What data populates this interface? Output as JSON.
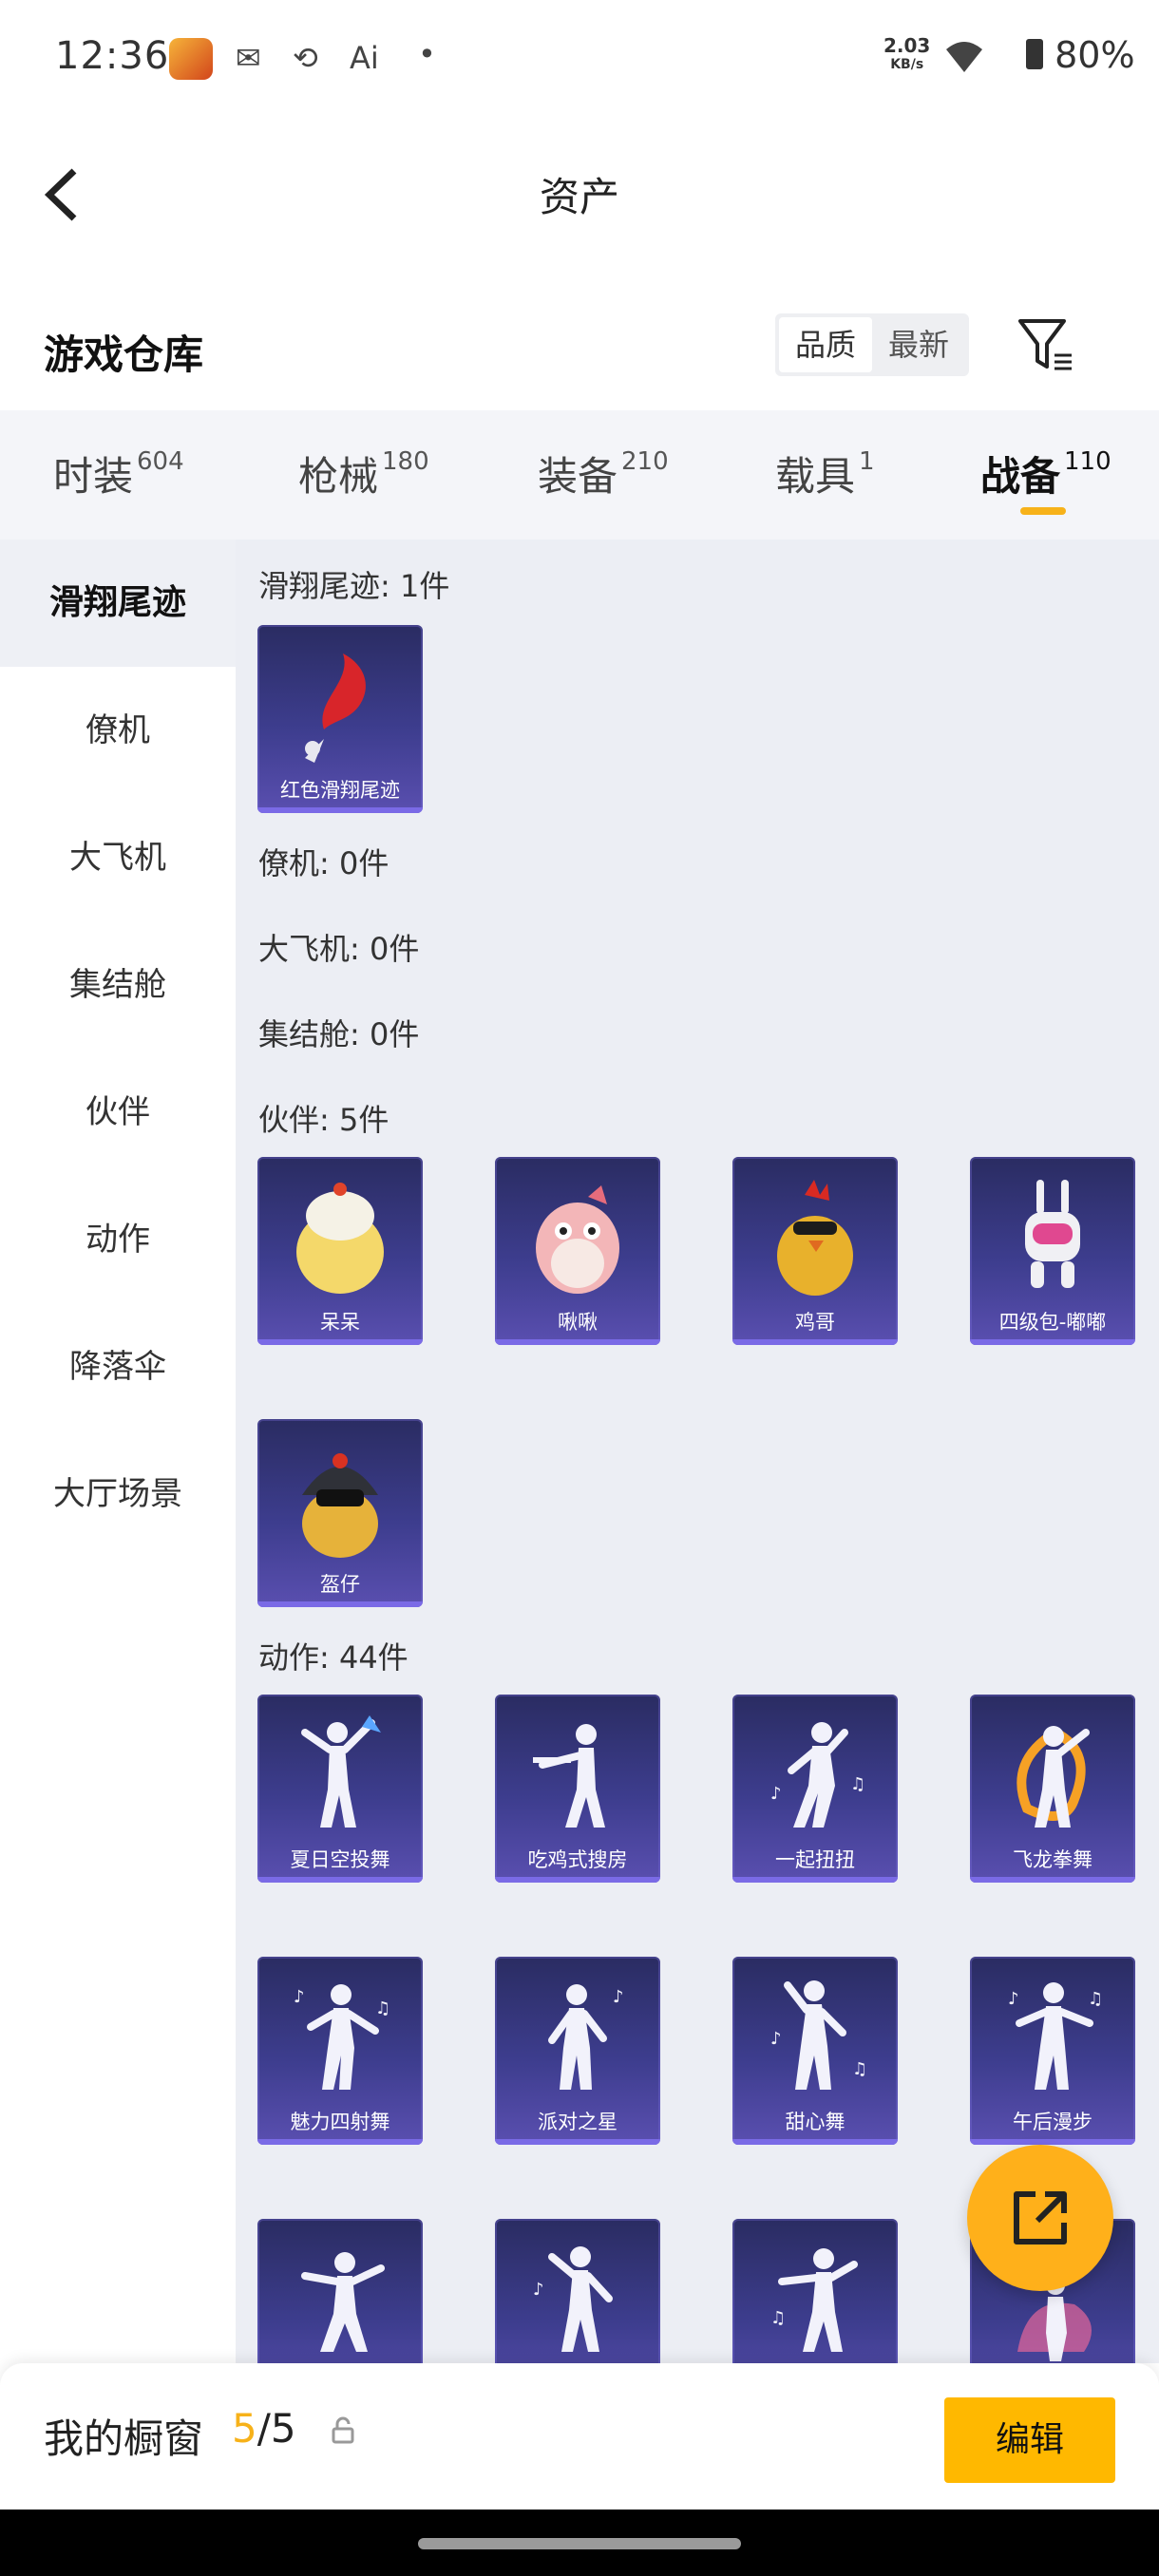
{
  "status_bar": {
    "time": "12:36",
    "speed_value": "2.03",
    "speed_unit": "KB/s",
    "battery": "80%",
    "icons": [
      "game-app-icon",
      "mail-icon",
      "phone-sync-icon",
      "ai-icon",
      "dot-icon",
      "wifi-icon",
      "battery-icon"
    ],
    "ai_label": "Ai"
  },
  "header": {
    "title": "资产"
  },
  "section": {
    "title": "游戏仓库",
    "sort_options": [
      "品质",
      "最新"
    ],
    "active_sort": "品质"
  },
  "tabs": [
    {
      "label": "时装",
      "count": "604"
    },
    {
      "label": "枪械",
      "count": "180"
    },
    {
      "label": "装备",
      "count": "210"
    },
    {
      "label": "载具",
      "count": "1"
    },
    {
      "label": "战备",
      "count": "110",
      "active": true
    }
  ],
  "left_nav": [
    "滑翔尾迹",
    "僚机",
    "大飞机",
    "集结舱",
    "伙伴",
    "动作",
    "降落伞",
    "大厅场景"
  ],
  "groups": {
    "glide": {
      "label": "滑翔尾迹: 1件",
      "items": [
        "红色滑翔尾迹"
      ]
    },
    "wingman": {
      "label": "僚机: 0件"
    },
    "plane": {
      "label": "大飞机: 0件"
    },
    "pod": {
      "label": "集结舱: 0件"
    },
    "partner": {
      "label": "伙伴: 5件",
      "items": [
        "呆呆",
        "啾啾",
        "鸡哥",
        "四级包-嘟嘟",
        "盔仔"
      ]
    },
    "emote": {
      "label": "动作: 44件",
      "items": [
        "夏日空投舞",
        "吃鸡式搜房",
        "一起扭扭",
        "飞龙拳舞",
        "魅力四射舞",
        "派对之星",
        "甜心舞",
        "午后漫步"
      ]
    }
  },
  "bottom": {
    "label": "我的橱窗",
    "current": "5",
    "total": "/5",
    "edit_label": "编辑"
  },
  "colors": {
    "accent": "#ffb800",
    "tab_bg": "#f4f5f9",
    "content_bg": "#eceef4",
    "card_bg": "#3d3d8e"
  }
}
